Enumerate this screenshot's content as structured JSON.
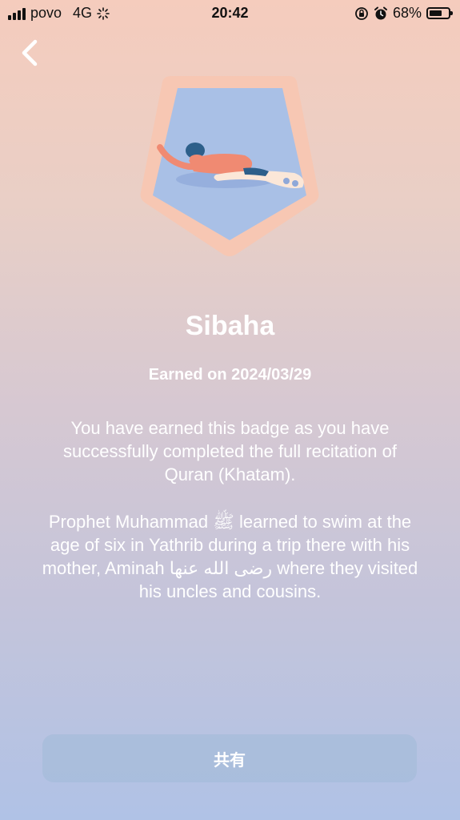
{
  "status_bar": {
    "carrier": "povo",
    "network": "4G",
    "time": "20:42",
    "battery": "68%",
    "battery_level": 0.68
  },
  "icons": {
    "back": "chevron-left-icon",
    "badge": "swimmer-badge-icon"
  },
  "badge": {
    "title": "Sibaha",
    "earned_on": "Earned on 2024/03/29",
    "description": "You have earned this badge as you have successfully completed the full recitation of Quran (Khatam).",
    "story": "Prophet Muhammad ﷺ learned to swim at the age of six in Yathrib during a trip there with his mother, Aminah رضى الله عنها where they visited his uncles and cousins."
  },
  "actions": {
    "share_label": "共有"
  },
  "colors": {
    "badge_border": "#f7c7b3",
    "badge_inner": "#a9c0e6",
    "swimmer_skin": "#f08a72",
    "swimmer_hair": "#2d5f8a"
  }
}
